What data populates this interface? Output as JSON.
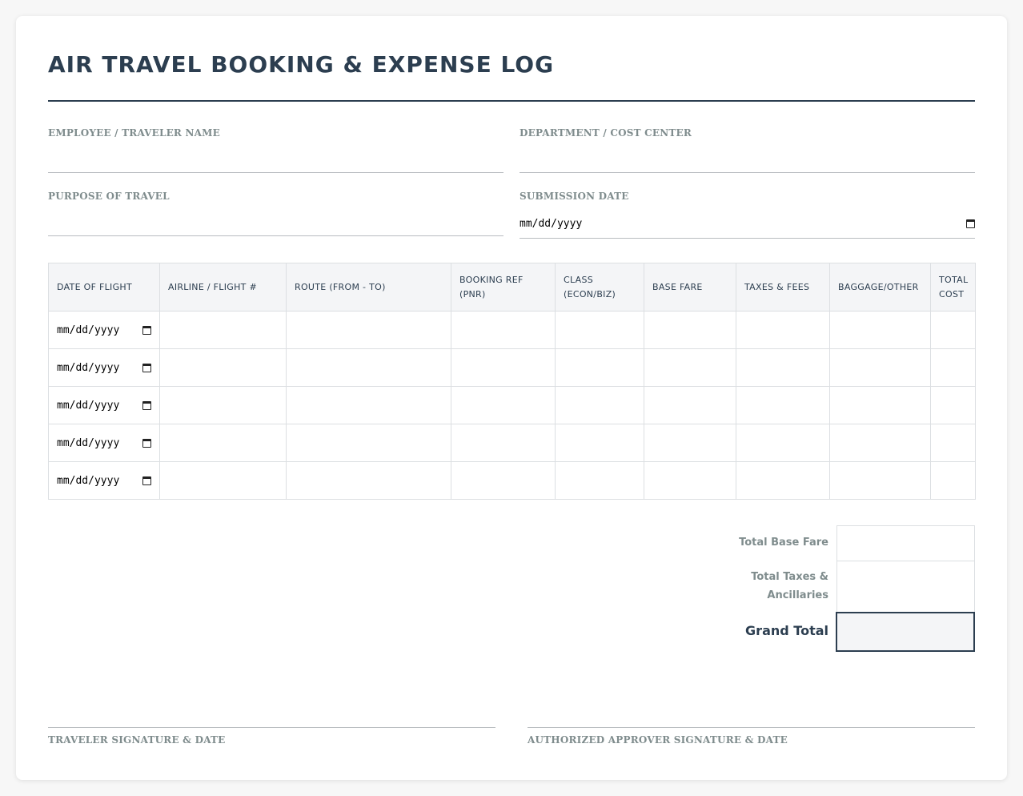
{
  "form": {
    "title": "AIR TRAVEL BOOKING & EXPENSE LOG",
    "employee_label": "EMPLOYEE / TRAVELER NAME",
    "employee_value": "",
    "department_label": "DEPARTMENT / COST CENTER",
    "department_value": "",
    "purpose_label": "PURPOSE OF TRAVEL",
    "purpose_value": "",
    "submission_label": "SUBMISSION DATE",
    "submission_placeholder": "mm/dd/yyyy"
  },
  "table": {
    "headers": [
      [
        "DATE OF FLIGHT"
      ],
      [
        "AIRLINE / FLIGHT #"
      ],
      [
        "ROUTE (FROM - TO)"
      ],
      [
        "BOOKING REF",
        "(PNR)"
      ],
      [
        "CLASS",
        "(ECON/BIZ)"
      ],
      [
        "BASE FARE"
      ],
      [
        "TAXES & FEES"
      ],
      [
        "BAGGAGE/OTHER"
      ],
      [
        "TOTAL",
        "COST"
      ]
    ],
    "date_placeholder": "mm/dd/yyyy",
    "rows": [
      {
        "date": "",
        "airline": "",
        "route": "",
        "pnr": "",
        "class": "",
        "base_fare": "",
        "taxes": "",
        "baggage": "",
        "total": ""
      },
      {
        "date": "",
        "airline": "",
        "route": "",
        "pnr": "",
        "class": "",
        "base_fare": "",
        "taxes": "",
        "baggage": "",
        "total": ""
      },
      {
        "date": "",
        "airline": "",
        "route": "",
        "pnr": "",
        "class": "",
        "base_fare": "",
        "taxes": "",
        "baggage": "",
        "total": ""
      },
      {
        "date": "",
        "airline": "",
        "route": "",
        "pnr": "",
        "class": "",
        "base_fare": "",
        "taxes": "",
        "baggage": "",
        "total": ""
      },
      {
        "date": "",
        "airline": "",
        "route": "",
        "pnr": "",
        "class": "",
        "base_fare": "",
        "taxes": "",
        "baggage": "",
        "total": ""
      }
    ]
  },
  "totals": {
    "base_fare_label": "Total Base Fare",
    "base_fare_value": "",
    "taxes_label_line1": "Total Taxes &",
    "taxes_label_line2": "Ancillaries",
    "taxes_value": "",
    "grand_label": "Grand Total",
    "grand_value": ""
  },
  "signatures": {
    "traveler_label": "TRAVELER SIGNATURE & DATE",
    "approver_label": "AUTHORIZED APPROVER SIGNATURE & DATE"
  },
  "icons": {
    "calendar": "calendar-icon"
  }
}
